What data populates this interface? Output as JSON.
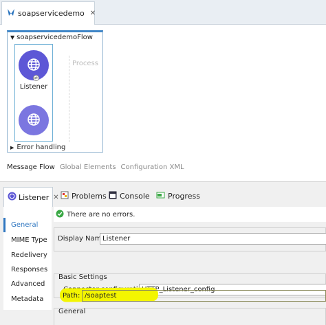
{
  "editor": {
    "tab_title": "soapservicedemo",
    "flow_name": "soapservicedemoFlow",
    "process_label": "Process",
    "listener_label": "Listener",
    "error_handling_label": "Error handling",
    "bottom_tabs": [
      "Message Flow",
      "Global Elements",
      "Configuration XML"
    ]
  },
  "properties": {
    "listener_tab_label": "Listener",
    "view_tabs": {
      "problems": "Problems",
      "console": "Console",
      "progress": "Progress"
    },
    "nav_items": [
      "General",
      "MIME Type",
      "Redelivery",
      "Responses",
      "Advanced",
      "Metadata"
    ],
    "status_message": "There are no errors.",
    "display_name_label": "Display Name:",
    "display_name_value": "Listener",
    "basic_settings_title": "Basic Settings",
    "connector_config_label": "Connector configuration:",
    "connector_config_value": "HTTP_Listener_config",
    "general_title": "General",
    "path_label": "Path:",
    "path_value": "/soaptest"
  },
  "colors": {
    "accent": "#2e76c0",
    "node": "#5d57d6",
    "highlight": "#f3f500",
    "success": "#3aa845"
  },
  "icons": [
    "mule-icon",
    "globe-icon",
    "check-icon",
    "problems-icon",
    "console-icon",
    "progress-icon",
    "chevron-down-icon",
    "chevron-right-icon",
    "close-icon"
  ]
}
